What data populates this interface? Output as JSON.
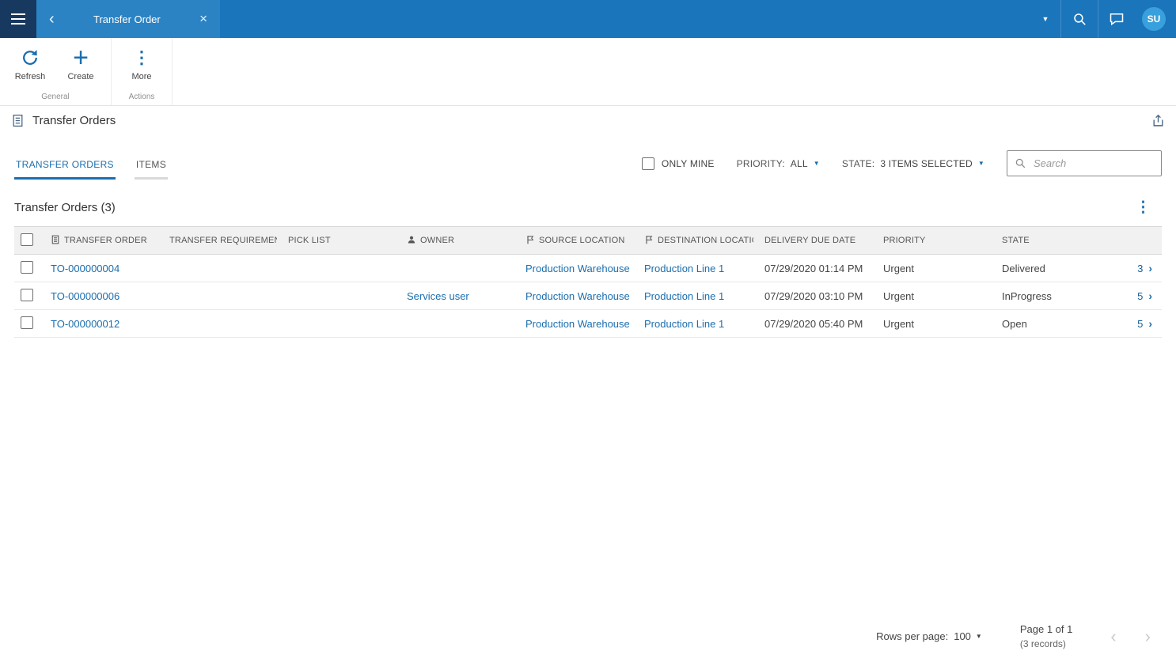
{
  "colors": {
    "topbar_bg": "#1b75bb",
    "topbar_dark_bg": "#17395f",
    "tab_active_bg": "#2b83c3",
    "accent_blue": "#1b6eae",
    "link_blue": "#1b6eae",
    "avatar_bg": "#38a0dc",
    "table_header_bg": "#f1f1f1"
  },
  "icons": {
    "menu": "hamburger",
    "back": "‹",
    "close": "×",
    "dropdown_caret": "▼",
    "search": "magnifier",
    "feedback": "speech-bubble",
    "refresh": "circular-arrow",
    "create": "+",
    "more": "⋮",
    "document": "document-outline",
    "owner": "person",
    "location": "flag",
    "popout": "arrow-up-from-square",
    "kebab": "⋮",
    "row_chevron": "›",
    "pager_prev": "‹",
    "pager_next": "›"
  },
  "topbar": {
    "tab_title": "Transfer Order",
    "avatar_initials": "SU"
  },
  "toolbar": {
    "refresh_label": "Refresh",
    "create_label": "Create",
    "more_label": "More",
    "group_general": "General",
    "group_actions": "Actions"
  },
  "page": {
    "title": "Transfer Orders"
  },
  "view_tabs": {
    "transfer_orders": "TRANSFER ORDERS",
    "items": "ITEMS"
  },
  "filters": {
    "only_mine_label": "ONLY MINE",
    "priority_label": "PRIORITY:",
    "priority_value": "ALL",
    "state_label": "STATE:",
    "state_value": "3 ITEMS SELECTED",
    "search_placeholder": "Search"
  },
  "grid": {
    "title": "Transfer Orders (3)",
    "columns": {
      "transfer_order": "TRANSFER ORDER",
      "transfer_requirement": "TRANSFER REQUIREMENT",
      "pick_list": "PICK LIST",
      "owner": "OWNER",
      "source_location": "SOURCE LOCATION",
      "destination_location": "DESTINATION LOCATION",
      "delivery_due_date": "DELIVERY DUE DATE",
      "priority": "PRIORITY",
      "state": "STATE"
    },
    "rows": [
      {
        "transfer_order": "TO-000000004",
        "transfer_requirement": "",
        "pick_list": "",
        "owner": "",
        "source_location": "Production Warehouse",
        "destination_location": "Production Line 1",
        "delivery_due_date": "07/29/2020 01:14 PM",
        "priority": "Urgent",
        "state": "Delivered",
        "count": "3"
      },
      {
        "transfer_order": "TO-000000006",
        "transfer_requirement": "",
        "pick_list": "",
        "owner": "Services user",
        "source_location": "Production Warehouse",
        "destination_location": "Production Line 1",
        "delivery_due_date": "07/29/2020 03:10 PM",
        "priority": "Urgent",
        "state": "InProgress",
        "count": "5"
      },
      {
        "transfer_order": "TO-000000012",
        "transfer_requirement": "",
        "pick_list": "",
        "owner": "",
        "source_location": "Production Warehouse",
        "destination_location": "Production Line 1",
        "delivery_due_date": "07/29/2020 05:40 PM",
        "priority": "Urgent",
        "state": "Open",
        "count": "5"
      }
    ]
  },
  "pagination": {
    "rows_per_page_label": "Rows per page:",
    "rows_per_page_value": "100",
    "page_info": "Page 1 of 1",
    "records_info": "(3 records)"
  }
}
